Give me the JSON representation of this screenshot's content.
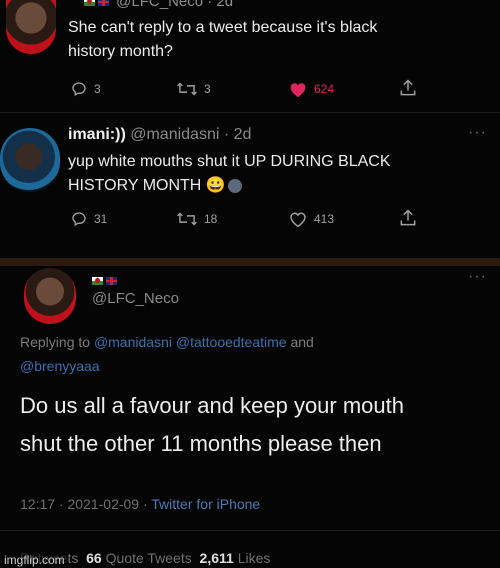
{
  "tweet1": {
    "handle_meta": "@LFC_Neco · 2d",
    "body_line1": "She can't reply to a tweet because it's black",
    "body_line2": "history month?",
    "replies": "3",
    "retweets": "3",
    "likes": "624",
    "like_color": "#e0245e"
  },
  "tweet2": {
    "name": "imani:))",
    "handle": "@manidasni · 2d",
    "body_line1": "yup white mouths shut it UP DURING BLACK",
    "body_line2": "HISTORY MONTH",
    "emoji": "😀",
    "replies": "31",
    "retweets": "18",
    "likes": "413"
  },
  "tweet3": {
    "handle": "@LFC_Neco",
    "replying_prefix": "Replying to ",
    "replying_mention1": "@manidasni",
    "replying_mention2": "@tattooedteatime",
    "replying_and": " and",
    "replying_mention3": "@brenyyaaa",
    "body_line1": "Do us all a favour and keep your mouth",
    "body_line2": "shut the other 11 months please then",
    "timestamp": "12:17 · 2021-02-09 · ",
    "source": "Twitter for iPhone",
    "retweets_count": "",
    "retweets_label": "Retweets",
    "quotes_count": "66",
    "quotes_label": "Quote Tweets",
    "likes_count": "2,611",
    "likes_label": "Likes"
  },
  "watermark": "imgflip.com"
}
